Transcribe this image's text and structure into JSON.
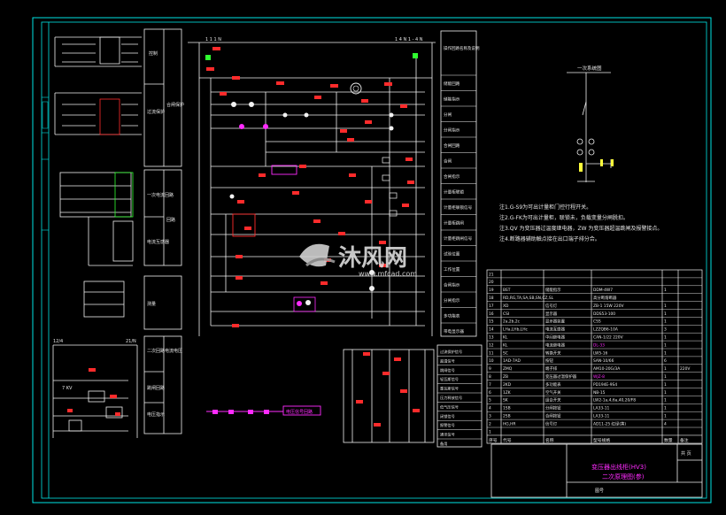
{
  "colors": {
    "background": "#000000",
    "frame": "#00e5e5",
    "wire": "#f2f2f2",
    "accent_red": "#ff2b2b",
    "accent_magenta": "#ff2bff",
    "accent_yellow": "#ffff3b",
    "accent_green": "#30ff30",
    "text": "#e6e6e6"
  },
  "top_bus": {
    "left_label": "1 1 1 N",
    "right_label": "1 4 N  1  - 4 N"
  },
  "function_blocks": {
    "b1": "控制",
    "b2": "过流保护",
    "b3": "一次电流回路",
    "b4": "电流互感器",
    "b5": "回路",
    "b6": "合闸保护",
    "b7": "测量",
    "b8": "二次回路电流电压",
    "b9": "跳闸回路",
    "b10": "电压指示"
  },
  "right_table": {
    "header": "操作回路名称及说明",
    "rows": [
      "储能回路",
      "储能指示",
      "分闸",
      "分闸指示",
      "合闸回路",
      "合闸",
      "合闸指示",
      "计量柜联锁",
      "计量柜联锁信号",
      "计量柜跳闸",
      "计量柜跳闸信号",
      "试验位置",
      "工作位置",
      "合闸指示",
      "分闸指示",
      "多功能表",
      "带电显示器"
    ]
  },
  "primary_title": "一次系统图",
  "notes": [
    "注1.G-S9为可出计量柜门控行程开关。",
    "注2.G-FK为可出计量柜，联锁未，负载变量分闸脱扣。",
    "注3.QV 为变压器过温度继电器，ZW 为变压器超温跳闸及报警接点。",
    "注4.断路器辅助触点接在出口端子排分合。"
  ],
  "bottom_left_labels": [
    "12/4",
    "21/N",
    "7 KV"
  ],
  "bottom_right_labels": [
    "过流保护信号",
    "超温信号",
    "跳闸信号",
    "轻瓦斯信号",
    "重瓦斯信号",
    "压力释放信号",
    "低气压信号",
    "闭锁信号",
    "报警信号",
    "通讯信号",
    "备用"
  ],
  "pink_box_label": "电压信号回路",
  "bom": {
    "rows": [
      [
        "21",
        "",
        "",
        "",
        "",
        ""
      ],
      [
        "20",
        "",
        "",
        "",
        "",
        ""
      ],
      [
        "19",
        "BST",
        "储能指示",
        "DDM-4W7",
        "1",
        ""
      ],
      [
        "18",
        "RD,RG,TA,SA,SB,SN,CZ,SL",
        "",
        "高分断熔断器",
        "",
        ""
      ],
      [
        "17",
        "XD",
        "信号灯",
        "ZB-1  15W 220V",
        "1",
        ""
      ],
      [
        "16",
        "CSI",
        "显示器",
        "DDS53-100",
        "1",
        ""
      ],
      [
        "15",
        "2a,2b,2c",
        "显示器装置",
        "CSS",
        "1",
        ""
      ],
      [
        "14",
        "LHa,LHb,LHc",
        "电流互感器",
        "LZZQB6-10A",
        "3",
        ""
      ],
      [
        "13",
        "KL",
        "中间继电器",
        "CAN-1/22  220V",
        "1",
        ""
      ],
      [
        "12",
        "KL",
        "电流继电器",
        "DL-33",
        "1",
        ""
      ],
      [
        "11",
        "SC",
        "转换开关",
        "LW5-16",
        "1",
        ""
      ],
      [
        "10",
        "1AD-7AD",
        "按钮",
        "SAN-10/66",
        "6",
        ""
      ],
      [
        "9",
        "ZMQ",
        "端子排",
        "AM10-20G/3A",
        "1",
        "220V"
      ],
      [
        "8",
        "ZB",
        "变压器过温保护器",
        "WJZ-8",
        "1",
        ""
      ],
      [
        "7",
        "2KD",
        "多功能表",
        "PD194E-9S4",
        "1",
        ""
      ],
      [
        "6",
        "1ZK",
        "空气开关",
        "NB-15",
        "1",
        ""
      ],
      [
        "5",
        "SK",
        "组合开关",
        "LW2-1a,4,6a,40,20/F8",
        "1",
        ""
      ],
      [
        "4",
        "1SB",
        "分闸按钮",
        "LA33-11",
        "1",
        ""
      ],
      [
        "3",
        "2SB",
        "合闸按钮",
        "LA33-11",
        "1",
        ""
      ],
      [
        "2",
        "HG,HR",
        "信号灯",
        "AD11-25  红绿(黄)",
        "4",
        ""
      ],
      [
        "1",
        "",
        "",
        "",
        "",
        ""
      ]
    ],
    "header": [
      "序号",
      "代号",
      "名称",
      "型号规格",
      "数量",
      "备注"
    ]
  },
  "title_block": {
    "line1": "变压器出线柜(HV3)",
    "line2": "二次原理图(参)",
    "drawing_no_label": "图号",
    "page_label": "共  页"
  },
  "watermark": {
    "brand": "沐风网",
    "url": "www.mfcad.com"
  }
}
